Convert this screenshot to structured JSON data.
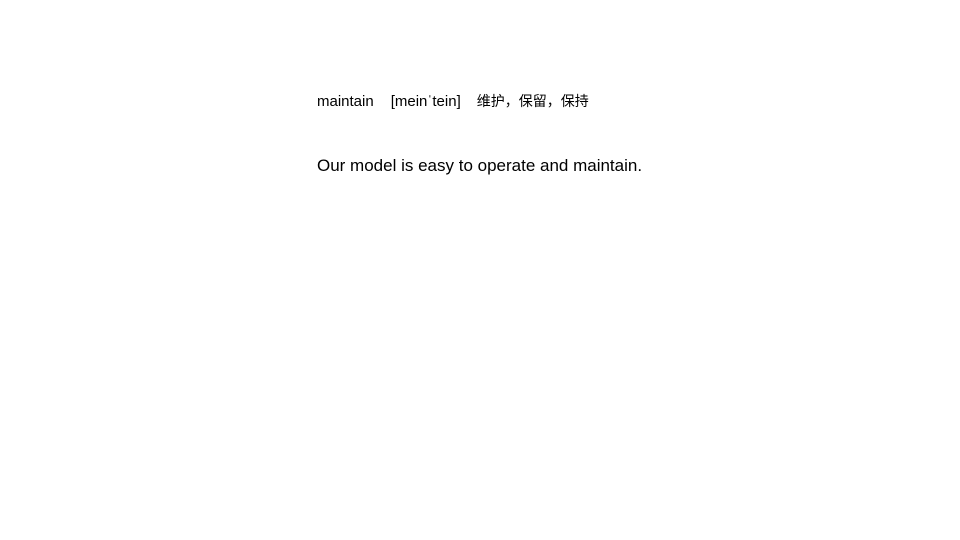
{
  "vocab": {
    "word": "maintain",
    "phonetic": "[meinˈtein]",
    "meaning": "维护，保留，保持"
  },
  "example": {
    "sentence": "Our model is easy to operate and maintain."
  }
}
